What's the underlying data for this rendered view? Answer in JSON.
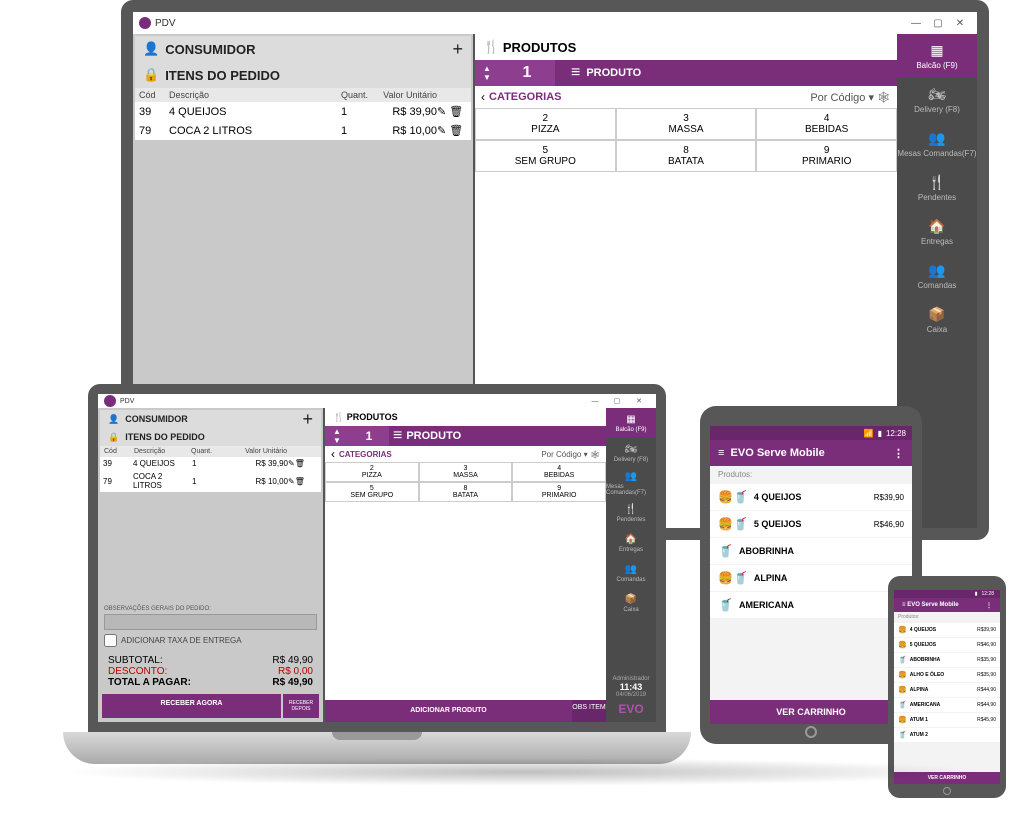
{
  "window": {
    "title": "PDV",
    "minimize": "—",
    "maximize": "▢",
    "close": "✕"
  },
  "customer": {
    "title": "CONSUMIDOR",
    "items_title": "ITENS DO PEDIDO",
    "headers": {
      "cod": "Cód",
      "desc": "Descrição",
      "quant": "Quant.",
      "valor": "Valor Unitário"
    },
    "items": [
      {
        "cod": "39",
        "desc": "4 QUEIJOS",
        "q": "1",
        "v": "R$ 39,90"
      },
      {
        "cod": "79",
        "desc": "COCA 2 LITROS",
        "q": "1",
        "v": "R$ 10,00"
      }
    ],
    "obs_label": "OBSERVAÇÕES GERAIS DO PEDIDO:",
    "tax_label": "ADICIONAR TAXA DE ENTREGA",
    "subtotal_label": "SUBTOTAL:",
    "subtotal": "R$ 49,90",
    "desconto_label": "DESCONTO:",
    "desconto": "R$ 0,00",
    "total_label": "TOTAL A PAGAR:",
    "total": "R$ 49,90",
    "receive_now": "RECEBER AGORA",
    "receive_later": "RECEBER DEPOIS"
  },
  "products": {
    "title": "PRODUTOS",
    "qty": "1",
    "qty_label": "PRODUTO",
    "cat_title": "CATEGORIAS",
    "sort_label": "Por Código",
    "cats": [
      {
        "n": "2",
        "name": "PIZZA"
      },
      {
        "n": "3",
        "name": "MASSA"
      },
      {
        "n": "4",
        "name": "BEBIDAS"
      },
      {
        "n": "5",
        "name": "SEM GRUPO"
      },
      {
        "n": "8",
        "name": "BATATA"
      },
      {
        "n": "9",
        "name": "PRIMARIO"
      }
    ],
    "add_label": "ADICIONAR PRODUTO",
    "obs_item": "OBS ITEM"
  },
  "rail": {
    "items": [
      {
        "label": "Balcão (F9)"
      },
      {
        "label": "Delivery (F8)"
      },
      {
        "label": "Mesas Comandas(F7)"
      },
      {
        "label": "Pendentes"
      },
      {
        "label": "Entregas"
      },
      {
        "label": "Comandas"
      },
      {
        "label": "Caixa"
      }
    ],
    "user": "Administrador",
    "time": "11:43",
    "date": "04/06/2019",
    "logo": "EVO"
  },
  "mobile": {
    "app_title": "EVO Serve Mobile",
    "status_time": "12:28",
    "list_label": "Produtos:",
    "items": [
      {
        "name": "4 QUEIJOS",
        "price": "R$39,90"
      },
      {
        "name": "5 QUEIJOS",
        "price": "R$46,90"
      },
      {
        "name": "ABOBRINHA",
        "price": ""
      },
      {
        "name": "ALPINA",
        "price": ""
      },
      {
        "name": "AMERICANA",
        "price": ""
      }
    ],
    "cart": "VER CARRINHO"
  },
  "phone": {
    "items": [
      {
        "name": "4 QUEIJOS",
        "price": "R$39,90"
      },
      {
        "name": "5 QUEIJOS",
        "price": "R$46,90"
      },
      {
        "name": "ABOBRINHA",
        "price": "R$35,90"
      },
      {
        "name": "ALHO E ÓLEO",
        "price": "R$35,90"
      },
      {
        "name": "ALPINA",
        "price": "R$44,90"
      },
      {
        "name": "AMERICANA",
        "price": "R$44,90"
      },
      {
        "name": "ATUM 1",
        "price": "R$45,90"
      },
      {
        "name": "ATUM 2",
        "price": ""
      }
    ]
  }
}
